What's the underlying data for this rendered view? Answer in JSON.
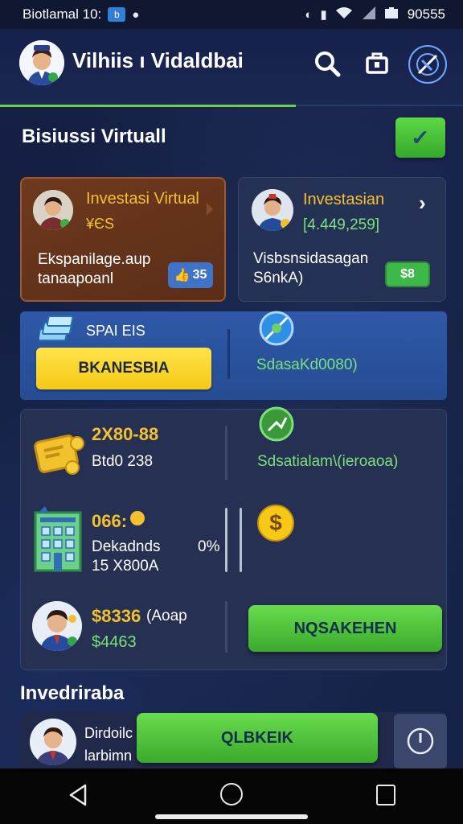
{
  "statusbar": {
    "left_text": "Biotlamal 10:",
    "left_icon_chip": "b",
    "right_text": "90555"
  },
  "header": {
    "title": "Vilhiis ı Vidaldbai"
  },
  "section1": {
    "title": "Bisiussi Virtuall"
  },
  "card_left": {
    "title": "Investasi Virtual",
    "sub": "¥ЄS",
    "desc1": "Ekspanilage.aup",
    "desc2": "tanaapoanl",
    "badge": "35"
  },
  "card_right": {
    "title": "Investasian",
    "value": "[4.449,259]",
    "desc1": "Visbsnsidasagan",
    "desc2": "S6nkA)",
    "badge": "$8"
  },
  "blue_band": {
    "label": "SPAI ЕIS",
    "button": "BKANESBIA",
    "right_text": "SdasaKd0080)"
  },
  "panel": {
    "row1_value": "2X80-88",
    "row1_sub": "Btd0 238",
    "row1_right": "Sdsatialam\\(ieroaoa)",
    "row2_value": "066:",
    "row2_label": "Dekadnds",
    "row2_sub": "15 X800A",
    "row2_percent": "0%",
    "row3_value": "$8336",
    "row3_paren": "(Aoap",
    "row3_sub": "$4463",
    "row3_button": "NQSAKEHEN"
  },
  "section2": {
    "title": "Invedriraba"
  },
  "bottom_card": {
    "line1": "Dirdoilc",
    "line2": "larbimn",
    "button": "QLBKEIK"
  },
  "icons": {
    "search": "search-icon",
    "store": "store-icon",
    "settings": "satellite-icon"
  },
  "colors": {
    "accent_green": "#5ed846",
    "accent_yellow": "#f5c916",
    "background": "#141e3c"
  }
}
